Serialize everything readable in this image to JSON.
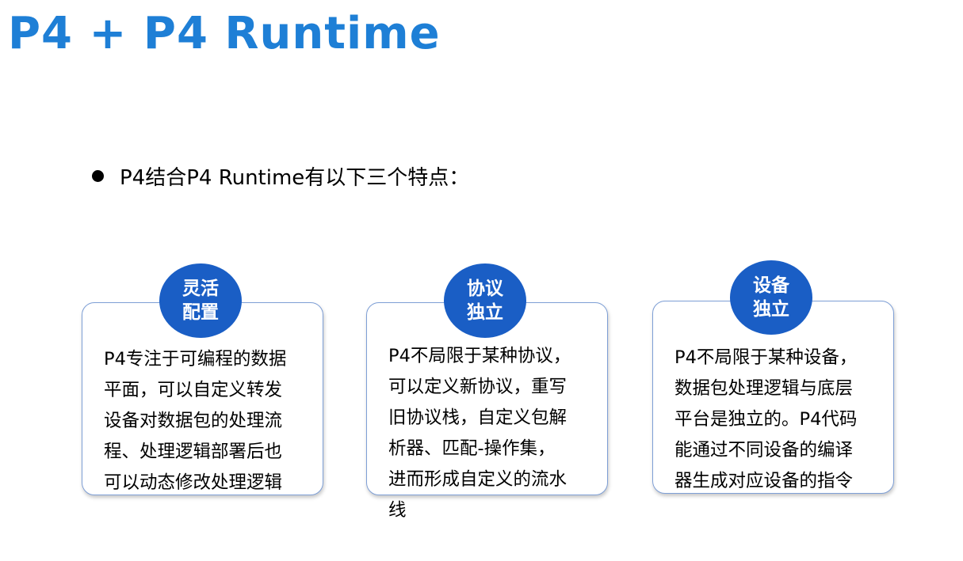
{
  "colors": {
    "title": "#1e7fd6",
    "badge": "#1a5ec5",
    "card_border": "#7e9fd6"
  },
  "title": "P4 + P4 Runtime",
  "bullet": {
    "icon": "bullet-dot-icon",
    "text": "P4结合P4 Runtime有以下三个特点："
  },
  "features": [
    {
      "badge": "灵活\n配置",
      "text": "P4专注于可编程的数据\n平面，可以自定义转发\n设备对数据包的处理流\n程、处理逻辑部署后也\n可以动态修改处理逻辑"
    },
    {
      "badge": "协议\n独立",
      "text": "P4不局限于某种协议，\n可以定义新协议，重写\n旧协议栈，自定义包解\n析器、匹配-操作集，\n进而形成自定义的流水\n线"
    },
    {
      "badge": "设备\n独立",
      "text": "P4不局限于某种设备，\n数据包处理逻辑与底层\n平台是独立的。P4代码\n能通过不同设备的编译\n器生成对应设备的指令"
    }
  ]
}
